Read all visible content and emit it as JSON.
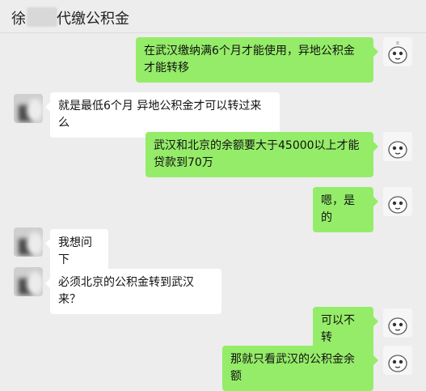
{
  "header": {
    "title_prefix": "徐",
    "title_rest": "代缴公积金"
  },
  "messages": [
    {
      "side": "out",
      "text": "在武汉缴纳满6个月才能使用，异地公积金才能转移"
    },
    {
      "side": "in",
      "text": "就是最低6个月 异地公积金才可以转过来么"
    },
    {
      "side": "out",
      "text": "武汉和北京的余额要大于45000以上才能贷款到70万"
    },
    {
      "side": "out",
      "text": "嗯，是的"
    },
    {
      "side": "in",
      "text": "我想问下"
    },
    {
      "side": "in",
      "text": "必须北京的公积金转到武汉来？"
    },
    {
      "side": "out",
      "text": "可以不转"
    },
    {
      "side": "out",
      "text": "那就只看武汉的公积金余额"
    }
  ],
  "colors": {
    "background": "#ededed",
    "outgoing_bubble": "#95ec69",
    "incoming_bubble": "#ffffff"
  }
}
